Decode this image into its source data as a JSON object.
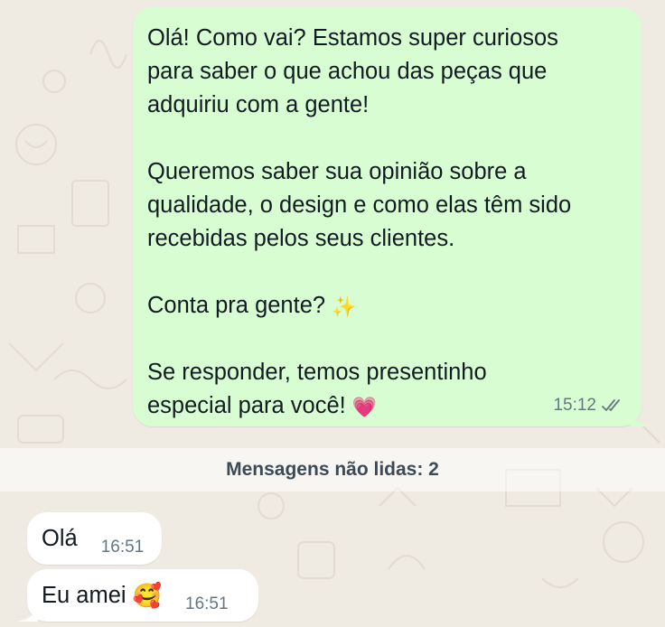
{
  "chat": {
    "outgoing": {
      "paragraphs": [
        "Olá! Como vai? Estamos super curiosos\npara saber o que achou das peças que\nadquiriu com a gente!",
        "Queremos saber sua opinião sobre a\nqualidade, o design e como elas têm sido\nrecebidas pelos seus clientes.",
        "Conta pra gente? ",
        "Se responder, temos presentinho\nespecial para você! "
      ],
      "emoji_sparkles": "✨",
      "emoji_heart": "💗",
      "time": "15:12",
      "status_icon": "double-check-icon"
    },
    "unread_divider": "Mensagens não lidas: 2",
    "incoming": [
      {
        "text": "Olá",
        "time": "16:51"
      },
      {
        "text": "Eu amei ",
        "emoji": "🥰",
        "time": "16:51"
      }
    ]
  },
  "colors": {
    "background": "#efeae2",
    "outgoing_bubble": "#d9fdd3",
    "incoming_bubble": "#ffffff",
    "text": "#111b21",
    "meta": "#667781"
  }
}
